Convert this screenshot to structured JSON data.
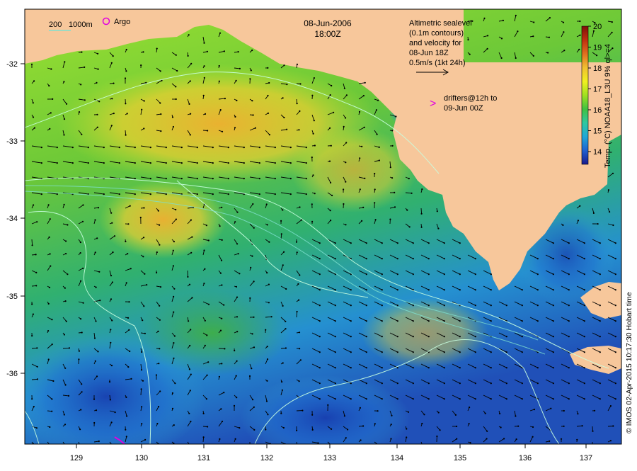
{
  "title": {
    "date": "08-Jun-2006",
    "time": "18:00Z"
  },
  "legend_bathy": {
    "label_200": "200",
    "label_1000": "1000m"
  },
  "legend_argo": {
    "label": "Argo",
    "color": "#e000e0"
  },
  "altimetry_note": {
    "line1": "Altimetric sealevel",
    "line2": "(0.1m contours)",
    "line3": "and velocity for",
    "line4": "08-Jun 18Z",
    "line5": "0.5m/s (1kt 24h)"
  },
  "drifters_note": {
    "symbol": ">",
    "line1": "drifters@12h to",
    "line2": "09-Jun 00Z"
  },
  "colorbar": {
    "title": "Temp. (°C) NOAA18_L3U 9% ql>=4",
    "ticks": [
      "14",
      "15",
      "16",
      "17",
      "18",
      "19",
      "20"
    ],
    "colors": [
      "#1a1a8c",
      "#2060d0",
      "#20a8d8",
      "#30c8a0",
      "#40c040",
      "#a0e020",
      "#f0f020",
      "#f0c030",
      "#e07020",
      "#c03010",
      "#801008"
    ]
  },
  "axes": {
    "x_ticks": [
      "129",
      "130",
      "131",
      "132",
      "133",
      "134",
      "135",
      "136",
      "137"
    ],
    "y_ticks": [
      "-32",
      "-33",
      "-34",
      "-35",
      "-36"
    ]
  },
  "credit": "© IMOS 02-Apr-2015 10:17:30 Hobart time",
  "colors": {
    "land": "#f7c79b",
    "ocean_warm": "#e8c030",
    "ocean_mid": "#40b848",
    "ocean_cool": "#2070d0",
    "contour": "#c8ffe0"
  }
}
